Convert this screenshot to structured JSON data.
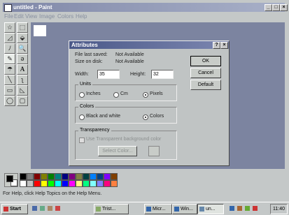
{
  "window": {
    "title": "untitled - Paint"
  },
  "menu": [
    "File",
    "Edit",
    "View",
    "Image",
    "Colors",
    "Help"
  ],
  "tools": [
    {
      "icon": "free-select-icon",
      "glyph": "☆"
    },
    {
      "icon": "select-icon",
      "glyph": "⬚"
    },
    {
      "icon": "eraser-icon",
      "glyph": "◿"
    },
    {
      "icon": "fill-icon",
      "glyph": "⬙"
    },
    {
      "icon": "eyedropper-icon",
      "glyph": "ﾉ"
    },
    {
      "icon": "magnifier-icon",
      "glyph": "🔍"
    },
    {
      "icon": "pencil-icon",
      "glyph": "✎"
    },
    {
      "icon": "brush-icon",
      "glyph": "ǝ"
    },
    {
      "icon": "airbrush-icon",
      "glyph": "☂"
    },
    {
      "icon": "text-icon",
      "glyph": "A"
    },
    {
      "icon": "line-icon",
      "glyph": "╲"
    },
    {
      "icon": "curve-icon",
      "glyph": "ʅ"
    },
    {
      "icon": "rectangle-icon",
      "glyph": "▭"
    },
    {
      "icon": "polygon-icon",
      "glyph": "◺"
    },
    {
      "icon": "ellipse-icon",
      "glyph": "◯"
    },
    {
      "icon": "rounded-rect-icon",
      "glyph": "▢"
    }
  ],
  "dialog": {
    "title": "Attributes",
    "file_last_saved_label": "File last saved:",
    "file_last_saved_value": "Not Available",
    "size_on_disk_label": "Size on disk:",
    "size_on_disk_value": "Not Available",
    "width_label": "Width:",
    "width_value": "35",
    "height_label": "Height:",
    "height_value": "32",
    "units_group": "Units",
    "units": [
      "Inches",
      "Cm",
      "Pixels"
    ],
    "units_selected": "Pixels",
    "colors_group": "Colors",
    "colors_options": [
      "Black and white",
      "Colors"
    ],
    "colors_selected": "Colors",
    "transparency_group": "Transparency",
    "transparency_checkbox": "Use Transparent background color",
    "select_color_button": "Select Color...",
    "ok_button": "OK",
    "cancel_button": "Cancel",
    "default_button": "Default"
  },
  "palette": {
    "primary": "#000000",
    "secondary": "#ffffff",
    "colors": [
      "#000000",
      "#808080",
      "#800000",
      "#808000",
      "#008000",
      "#008080",
      "#000080",
      "#800080",
      "#808040",
      "#004040",
      "#0080ff",
      "#004080",
      "#8000ff",
      "#804000",
      "#ffffff",
      "#c0c0c0",
      "#ff0000",
      "#ffff00",
      "#00ff00",
      "#00ffff",
      "#0000ff",
      "#ff00ff",
      "#ffff80",
      "#00ff80",
      "#80ffff",
      "#8080ff",
      "#ff0080",
      "#ff8040"
    ]
  },
  "status": "For Help, click Help Topics on the Help Menu.",
  "taskbar": {
    "start": "Start",
    "buttons": [
      "Trist...",
      "Micr...",
      "Win...",
      "un..."
    ],
    "clock": "11:40"
  }
}
